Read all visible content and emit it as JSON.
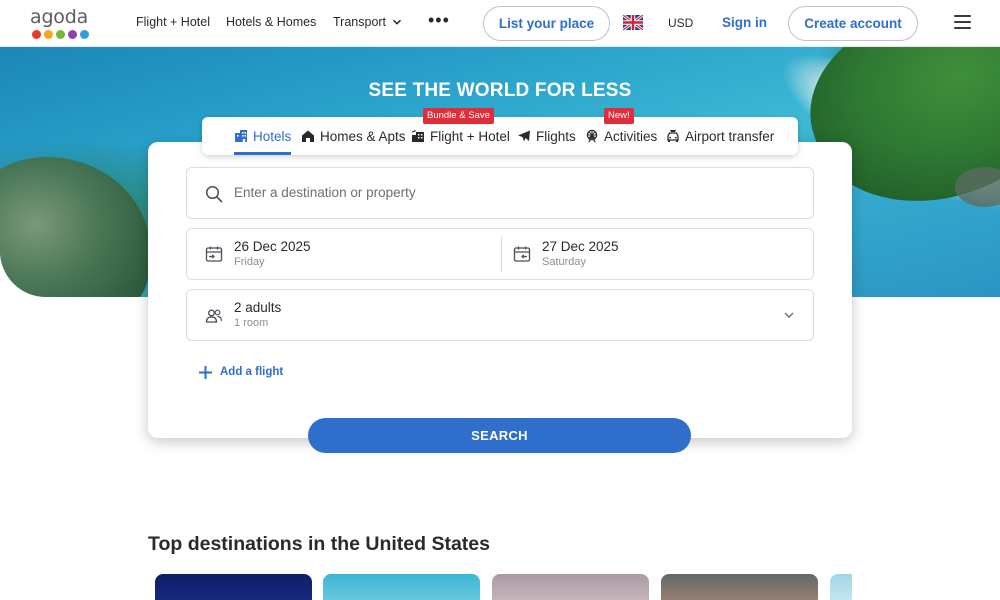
{
  "header": {
    "logo_text": "agoda",
    "logo_dot_colors": [
      "#e4392c",
      "#f5a623",
      "#7ab631",
      "#8e44ad",
      "#2f9ed9"
    ],
    "nav": [
      "Flight + Hotel",
      "Hotels & Homes",
      "Transport"
    ],
    "more": "•••",
    "list_place": "List your place",
    "currency": "USD",
    "sign_in": "Sign in",
    "create_account": "Create account",
    "flag_icon": "uk-flag-icon",
    "menu_icon": "hamburger-menu-icon"
  },
  "hero": {
    "title": "SEE THE WORLD FOR LESS"
  },
  "tabs": [
    {
      "label": "Hotels",
      "icon": "hotel-icon",
      "active": true,
      "badge": ""
    },
    {
      "label": "Homes & Apts",
      "icon": "home-icon",
      "active": false,
      "badge": ""
    },
    {
      "label": "Flight + Hotel",
      "icon": "flight-hotel-icon",
      "active": false,
      "badge": "Bundle & Save"
    },
    {
      "label": "Flights",
      "icon": "plane-icon",
      "active": false,
      "badge": ""
    },
    {
      "label": "Activities",
      "icon": "ferris-wheel-icon",
      "active": false,
      "badge": "New!"
    },
    {
      "label": "Airport transfer",
      "icon": "car-icon",
      "active": false,
      "badge": ""
    }
  ],
  "search": {
    "destination_placeholder": "Enter a destination or property",
    "checkin": {
      "date": "26 Dec 2025",
      "day": "Friday"
    },
    "checkout": {
      "date": "27 Dec 2025",
      "day": "Saturday"
    },
    "occupancy": {
      "main": "2 adults",
      "sub": "1 room"
    },
    "add_flight": "Add a flight",
    "search_button": "SEARCH",
    "accent_color": "#2f6ecb"
  },
  "destinations": {
    "title": "Top destinations in the United States",
    "card_colors": [
      [
        "#0f1f66",
        "#1a2f8a"
      ],
      [
        "#3bb6d6",
        "#7fd2e4"
      ],
      [
        "#a99aa5",
        "#d4c2c4"
      ],
      [
        "#5f6a66",
        "#b98a7c"
      ],
      [
        "#9fd6ea",
        "#d5eef6"
      ]
    ]
  }
}
